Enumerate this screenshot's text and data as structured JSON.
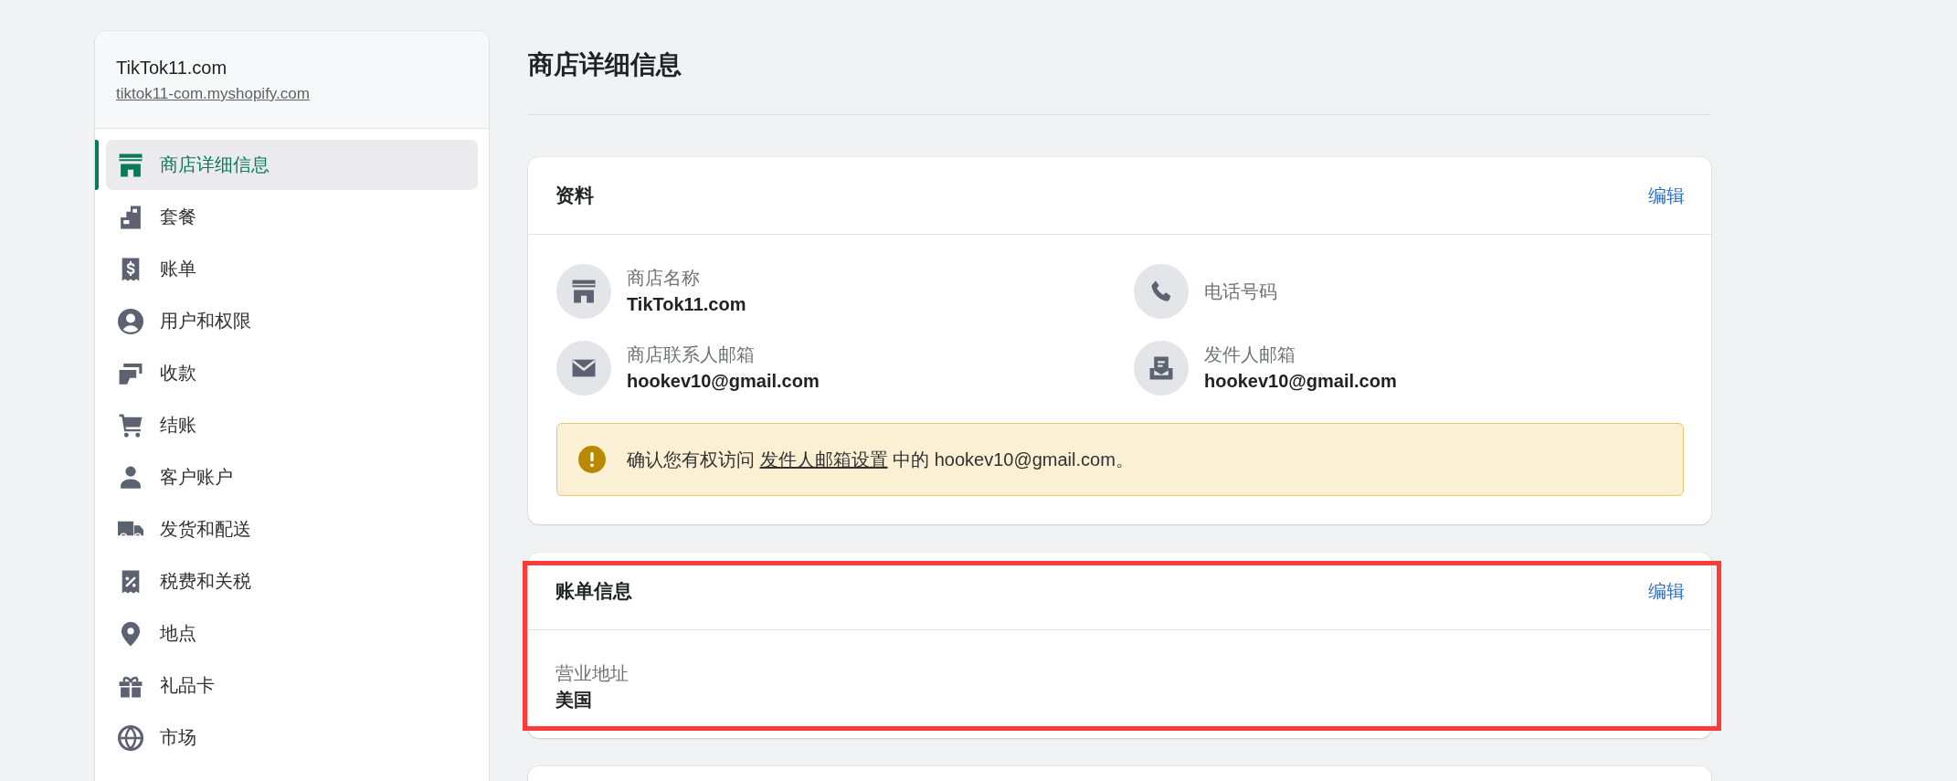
{
  "sidebar": {
    "store_name": "TikTok11.com",
    "store_url": "tiktok11-com.myshopify.com",
    "items": [
      {
        "label": "商店详细信息",
        "selected": true
      },
      {
        "label": "套餐",
        "selected": false
      },
      {
        "label": "账单",
        "selected": false
      },
      {
        "label": "用户和权限",
        "selected": false
      },
      {
        "label": "收款",
        "selected": false
      },
      {
        "label": "结账",
        "selected": false
      },
      {
        "label": "客户账户",
        "selected": false
      },
      {
        "label": "发货和配送",
        "selected": false
      },
      {
        "label": "税费和关税",
        "selected": false
      },
      {
        "label": "地点",
        "selected": false
      },
      {
        "label": "礼品卡",
        "selected": false
      },
      {
        "label": "市场",
        "selected": false
      }
    ]
  },
  "page": {
    "title": "商店详细信息"
  },
  "cards": [
    {
      "kind": "profile",
      "title": "资料",
      "action": "编辑",
      "highlighted": false,
      "fields": [
        {
          "label": "商店名称",
          "value": "TikTok11.com"
        },
        {
          "label": "电话号码"
        },
        {
          "label": "商店联系人邮箱",
          "value": "hookev10@gmail.com"
        },
        {
          "label": "发件人邮箱",
          "value": "hookev10@gmail.com"
        }
      ],
      "notice": {
        "text_before": "确认您有权访问",
        "link": "发件人邮箱设置",
        "text_after": "中的 hookev10@gmail.com。"
      }
    },
    {
      "kind": "billing",
      "title": "账单信息",
      "action": "编辑",
      "highlighted": true,
      "fields": [
        {
          "label": "营业地址",
          "value": "美国"
        }
      ]
    }
  ]
}
